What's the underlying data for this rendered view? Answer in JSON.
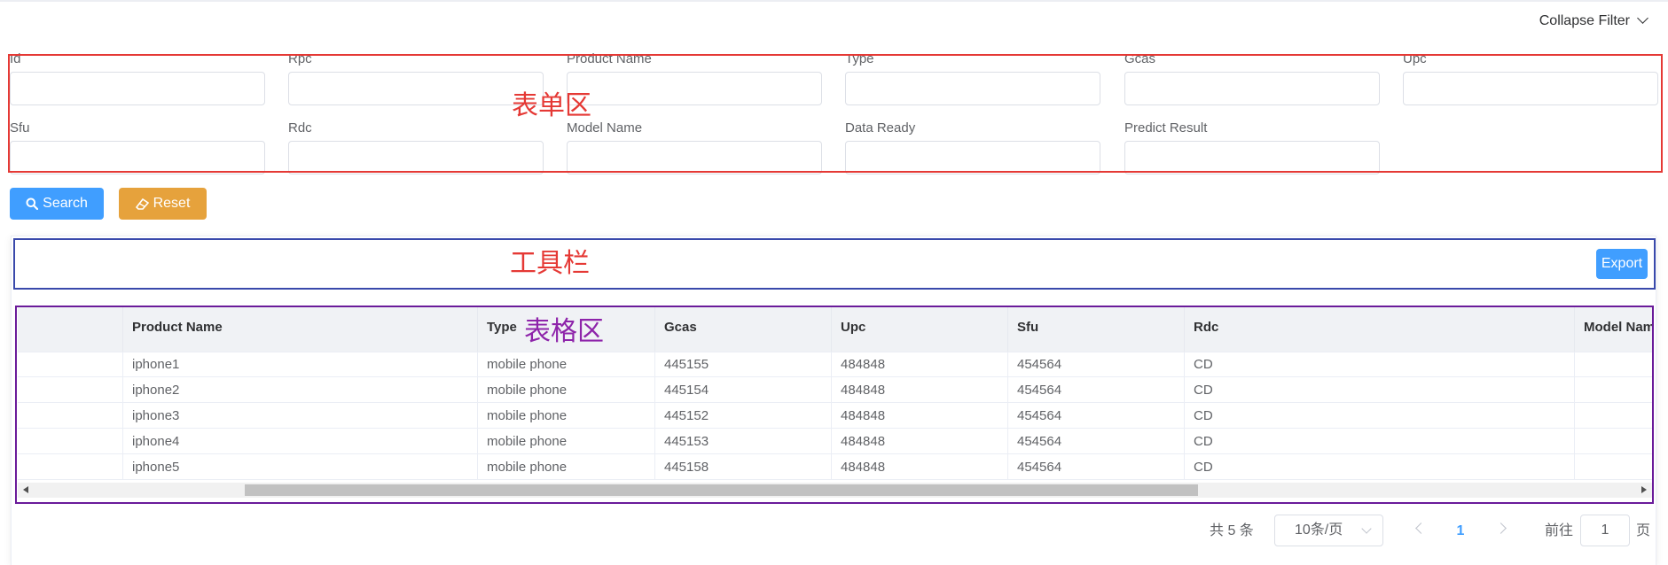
{
  "header": {
    "collapse_label": "Collapse Filter"
  },
  "filters": {
    "row1": [
      {
        "label": "Id",
        "value": ""
      },
      {
        "label": "Rpc",
        "value": ""
      },
      {
        "label": "Product Name",
        "value": ""
      },
      {
        "label": "Type",
        "value": ""
      },
      {
        "label": "Gcas",
        "value": ""
      },
      {
        "label": "Upc",
        "value": ""
      }
    ],
    "row2": [
      {
        "label": "Sfu",
        "value": ""
      },
      {
        "label": "Rdc",
        "value": ""
      },
      {
        "label": "Model Name",
        "value": ""
      },
      {
        "label": "Data Ready",
        "value": ""
      },
      {
        "label": "Predict Result",
        "value": ""
      }
    ]
  },
  "actions": {
    "search_label": "Search",
    "reset_label": "Reset"
  },
  "toolbar": {
    "export_label": "Export"
  },
  "annotations": {
    "form_area": {
      "text": "表单区",
      "color": "#e53935"
    },
    "toolbar_area": {
      "text": "工具栏",
      "color": "#e53935"
    },
    "table_area": {
      "text": "表格区",
      "color": "#8e24aa"
    },
    "form_box_color": "#e53935",
    "toolbar_box_color": "#3949ab",
    "table_box_color": "#6a1b9a"
  },
  "table": {
    "columns": [
      "",
      "Product Name",
      "Type",
      "Gcas",
      "Upc",
      "Sfu",
      "Rdc",
      "Model Nam"
    ],
    "rows": [
      [
        "",
        "iphone1",
        "mobile phone",
        "445155",
        "484848",
        "454564",
        "CD",
        ""
      ],
      [
        "",
        "iphone2",
        "mobile phone",
        "445154",
        "484848",
        "454564",
        "CD",
        ""
      ],
      [
        "",
        "iphone3",
        "mobile phone",
        "445152",
        "484848",
        "454564",
        "CD",
        ""
      ],
      [
        "",
        "iphone4",
        "mobile phone",
        "445153",
        "484848",
        "454564",
        "CD",
        ""
      ],
      [
        "",
        "iphone5",
        "mobile phone",
        "445158",
        "484848",
        "454564",
        "CD",
        ""
      ]
    ]
  },
  "pagination": {
    "total_text": "共 5 条",
    "page_size": "10条/页",
    "current_page": "1",
    "goto_prefix": "前往",
    "goto_value": "1",
    "goto_suffix": "页"
  },
  "colors": {
    "primary": "#409eff",
    "warning": "#e6a23c"
  }
}
